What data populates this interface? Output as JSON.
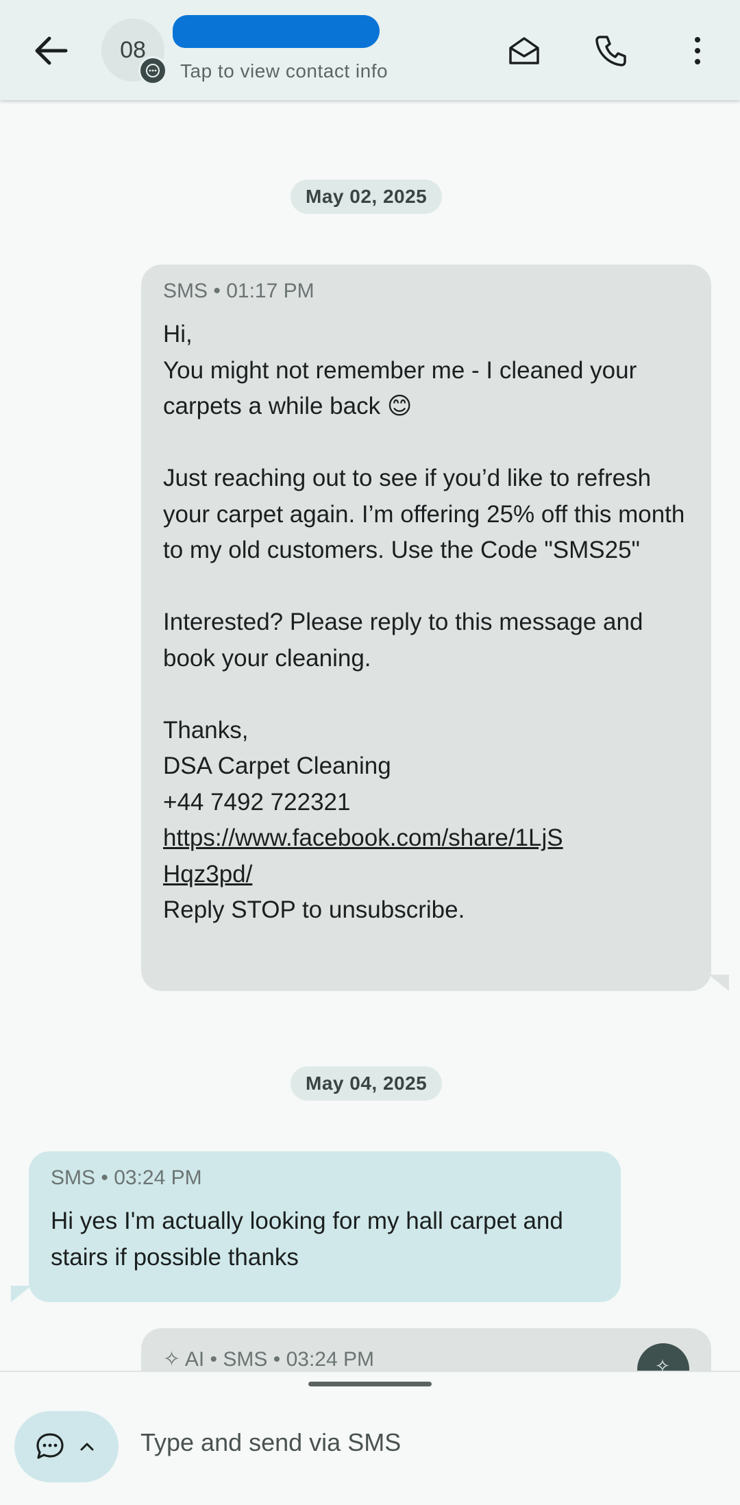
{
  "header": {
    "avatar_text": "08",
    "contact_subtitle": "Tap to view contact info"
  },
  "conversation": {
    "date1": "May 02, 2025",
    "message1": {
      "channel": "SMS",
      "time": "01:17 PM",
      "lines": [
        "Hi,",
        "You might not remember me - I cleaned your carpets a while back 😊",
        "",
        "Just reaching out to see if you’d like to refresh your carpet again. I’m offering 25% off this month to my old customers. Use the Code \"SMS25\"",
        "",
        "Interested? Please reply to this message and book your cleaning.",
        "",
        "Thanks,",
        "DSA Carpet Cleaning",
        "+44 7492 722321"
      ],
      "link": "https://www.facebook.com/share/1LjSHqz3pd/",
      "footer": "Reply STOP to unsubscribe."
    },
    "date2": "May 04, 2025",
    "message2": {
      "channel": "SMS",
      "time": "03:24 PM",
      "text": "Hi yes I'm actually looking for my hall carpet and stairs if possible thanks"
    },
    "message3": {
      "prefix": "AI",
      "channel": "SMS",
      "time": "03:24 PM"
    }
  },
  "composer": {
    "placeholder": "Type and send via SMS"
  }
}
